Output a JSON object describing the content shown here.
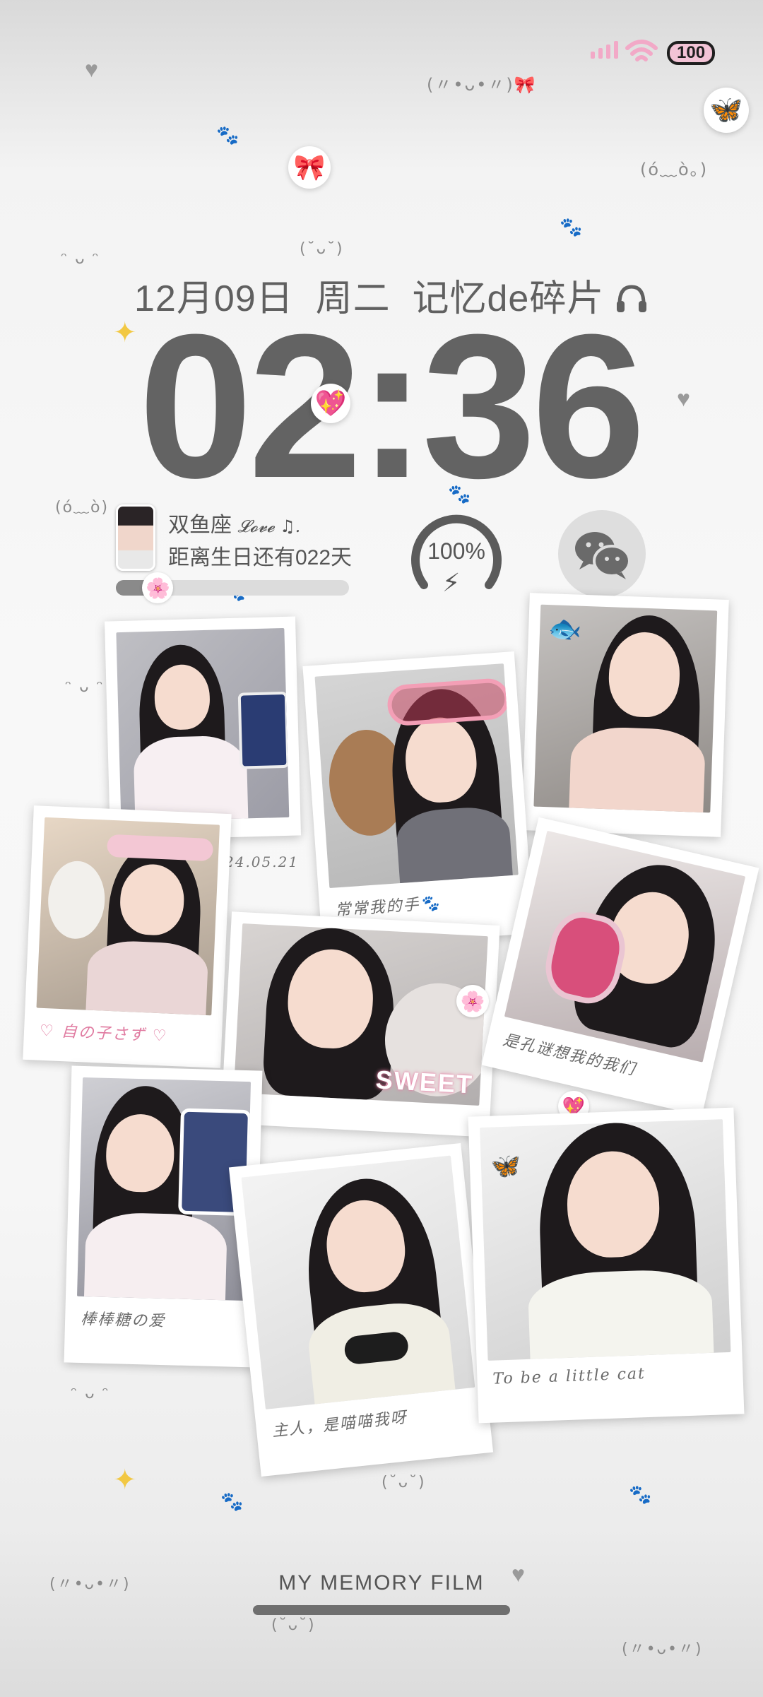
{
  "status_bar": {
    "battery": "100"
  },
  "lock_screen": {
    "date": "12月09日",
    "weekday": "周二",
    "tagline": "记忆de碎片",
    "time": "02:36"
  },
  "widgets": {
    "zodiac_text": "双鱼座",
    "zodiac_decoration": "𝓛𝓸𝓿𝓮 ♫.",
    "birthday_text": "距离生日还有022天",
    "birthday_progress": 0.18,
    "battery_percent": "100%",
    "battery_level": 1.0
  },
  "captions": {
    "photo1_date": "24.05.21",
    "photo2": "常常我的手🐾",
    "photo4": "♡ 自の子さず ♡",
    "photo5_sticker": "SWEET",
    "photo6": "是孔谜想我的我们",
    "photo7": "棒棒糖の爱",
    "photo8": "主人，是喵喵我呀",
    "photo9": "To be a little cat"
  },
  "footer": {
    "title": "MY MEMORY FILM"
  },
  "icons": {
    "battery_badge": "battery-badge-icon",
    "butterfly": "butterfly-icon",
    "bow": "bow-icon",
    "headphones": "headphones-icon",
    "heart": "heart-icon",
    "wechat": "wechat-icon"
  },
  "colors": {
    "accent_pink": "#f2a9c7",
    "clock_gray": "#636363",
    "background": "#f6f6f6"
  }
}
